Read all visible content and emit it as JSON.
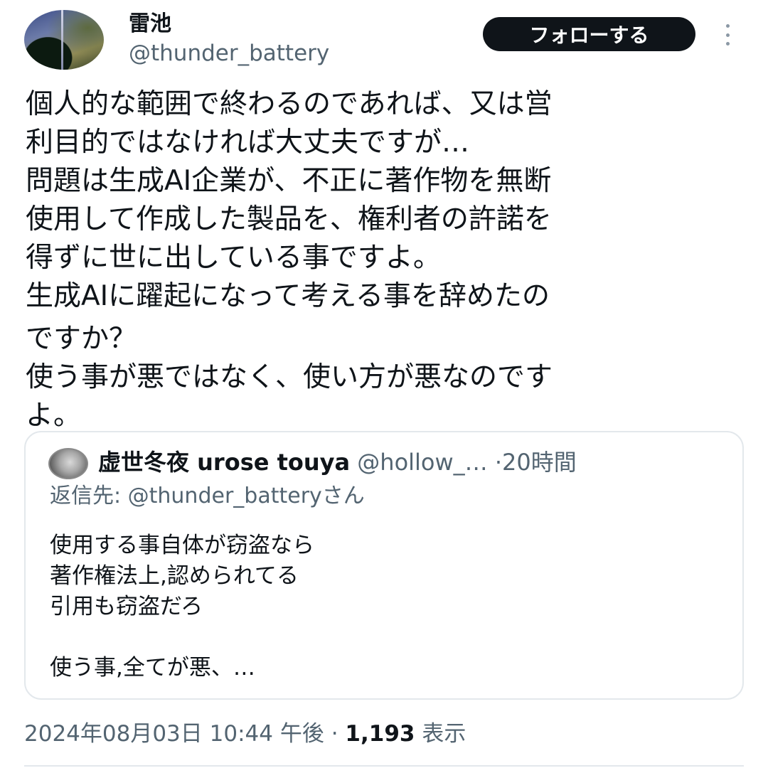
{
  "author": {
    "display_name": "雷池",
    "handle": "@thunder_battery"
  },
  "actions": {
    "follow_label": "フォローする",
    "more_icon": "more-vertical-icon"
  },
  "tweet": {
    "lines": [
      "個人的な範囲で終わるのであれば、又は営",
      "利目的ではなければ大丈夫ですが…",
      "問題は生成AI企業が、不正に著作物を無断",
      "使用して作成した製品を、権利者の許諾を",
      "得ずに世に出している事ですよ。",
      "生成AIに躍起になって考える事を辞めたの",
      "ですか？",
      "使う事が悪ではなく、使い方が悪なのです",
      "よ。"
    ]
  },
  "quote": {
    "display_name": "虚世冬夜 urose touya",
    "handle": "@hollow_…",
    "separator": "·",
    "time": "20時間",
    "reply_to": "返信先: @thunder_batteryさん",
    "lines": [
      "使用する事自体が窃盗なら",
      "著作権法上,認められてる",
      "引用も窃盗だろ",
      "",
      "使う事,全てが悪、…"
    ]
  },
  "meta": {
    "datetime": "2024年08月03日 10:44 午後",
    "separator": "·",
    "views_count": "1,193",
    "views_label": "表示"
  }
}
